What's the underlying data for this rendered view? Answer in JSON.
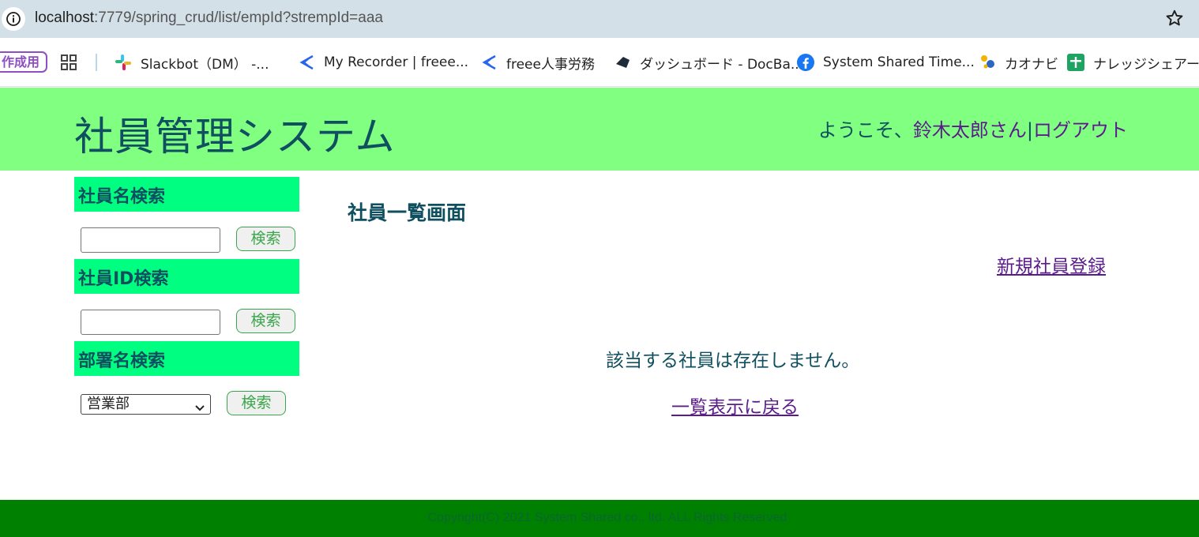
{
  "browser": {
    "url_host": "localhost",
    "url_rest": ":7779/spring_crud/list/empId?strempId=aaa",
    "icons": {
      "info": "info-icon",
      "star": "star-bookmark-icon"
    }
  },
  "bookmarks": {
    "pill_label": "作成用",
    "items": [
      {
        "label": "Slackbot（DM） -...",
        "icon": "slack-icon"
      },
      {
        "label": "My Recorder | freee...",
        "icon": "freee-icon"
      },
      {
        "label": "freee人事労務",
        "icon": "freee-icon"
      },
      {
        "label": "ダッシュボード - DocBa...",
        "icon": "docbase-icon"
      },
      {
        "label": "System Shared Time...",
        "icon": "facebook-icon"
      },
      {
        "label": "カオナビ",
        "icon": "kaonavi-icon"
      },
      {
        "label": "ナレッジシェアード_情",
        "icon": "sheets-icon"
      }
    ]
  },
  "header": {
    "title": "社員管理システム",
    "welcome_prefix": "ようこそ、",
    "user_name": "鈴木太郎さん",
    "separator": "|",
    "logout": "ログアウト"
  },
  "sidebar": {
    "name_search_heading": "社員名検索",
    "id_search_heading": "社員ID検索",
    "dept_search_heading": "部署名検索",
    "search_button": "検索",
    "name_value": "",
    "id_value": "",
    "dept_selected": "営業部"
  },
  "main": {
    "title": "社員一覧画面",
    "new_employee_link": "新規社員登録",
    "empty_message": "該当する社員は存在しません。",
    "back_link": "一覧表示に戻る"
  },
  "footer": {
    "copyright": "Copyright(C) 2021 System Shared co., ltd. ALL Rights Reserved"
  },
  "colors": {
    "header_bg": "#80ff80",
    "sidebar_heading_bg": "#00ff80",
    "footer_bg": "#008000",
    "text": "#0f4f5f",
    "link": "#5b1b8a"
  }
}
